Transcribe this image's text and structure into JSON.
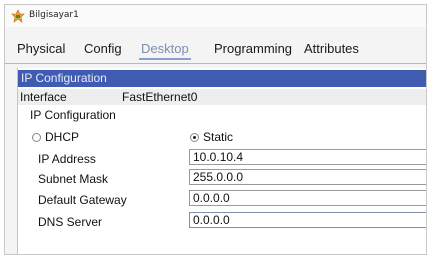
{
  "window": {
    "title": "Bilgisayar1"
  },
  "tabs": [
    {
      "label": "Physical"
    },
    {
      "label": "Config"
    },
    {
      "label": "Desktop"
    },
    {
      "label": "Programming"
    },
    {
      "label": "Attributes"
    }
  ],
  "active_tab": "Desktop",
  "panel": {
    "header": "IP Configuration",
    "interface_label": "Interface",
    "interface_value": "FastEthernet0",
    "section_label": "IP Configuration",
    "dhcp_label": "DHCP",
    "static_label": "Static",
    "mode": "Static",
    "fields": {
      "ip_address": {
        "label": "IP Address",
        "value": "10.0.10.4"
      },
      "subnet_mask": {
        "label": "Subnet Mask",
        "value": "255.0.0.0"
      },
      "default_gateway": {
        "label": "Default Gateway",
        "value": "0.0.0.0"
      },
      "dns_server": {
        "label": "DNS Server",
        "value": "0.0.0.0"
      }
    }
  },
  "colors": {
    "header_bg": "#3f5bb2",
    "active_tab": "#7b8fb0"
  },
  "icons": {
    "app": "pc-icon"
  }
}
